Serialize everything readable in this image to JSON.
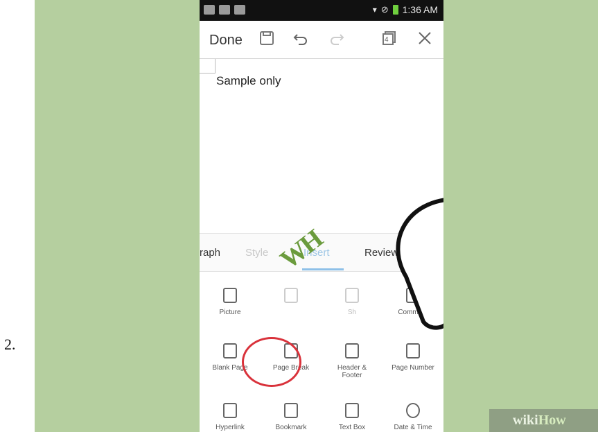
{
  "step_number": "2.",
  "status_bar": {
    "time": "1:36 AM",
    "icons": [
      "image-icon",
      "gallery-icon",
      "clipboard-icon",
      "signal-icon",
      "no-sim-icon",
      "battery-icon"
    ]
  },
  "toolbar": {
    "done_label": "Done",
    "icons": [
      "save-icon",
      "undo-icon",
      "redo-icon",
      "page-count-icon",
      "close-icon"
    ],
    "page_count": "4"
  },
  "document": {
    "text": "Sample only"
  },
  "tabs": {
    "items": [
      {
        "label": "raph"
      },
      {
        "label": "Style"
      },
      {
        "label": "Insert"
      },
      {
        "label": "Review"
      }
    ]
  },
  "insert_grid": {
    "row1": [
      {
        "label": "Picture",
        "icon": "picture-icon"
      },
      {
        "label": "",
        "icon": "table-icon"
      },
      {
        "label": "Sh",
        "icon": "shape-icon"
      },
      {
        "label": "Comment",
        "icon": "comment-icon"
      }
    ],
    "row2": [
      {
        "label": "Blank Page",
        "icon": "blank-page-icon"
      },
      {
        "label": "Page Break",
        "icon": "page-break-icon"
      },
      {
        "label": "Header & Footer",
        "icon": "header-footer-icon"
      },
      {
        "label": "Page Number",
        "icon": "page-number-icon"
      }
    ],
    "row3": [
      {
        "label": "Hyperlink",
        "icon": "hyperlink-icon"
      },
      {
        "label": "Bookmark",
        "icon": "bookmark-icon"
      },
      {
        "label": "Text Box",
        "icon": "text-box-icon"
      },
      {
        "label": "Date & Time",
        "icon": "date-time-icon"
      }
    ]
  },
  "overlay": {
    "hand_logo_text": "WH",
    "watermark_wiki": "wiki",
    "watermark_how": "How"
  },
  "colors": {
    "background": "#b5cf9f",
    "highlight_ring": "#d9323b",
    "active_tab": "#9fc7e6"
  }
}
